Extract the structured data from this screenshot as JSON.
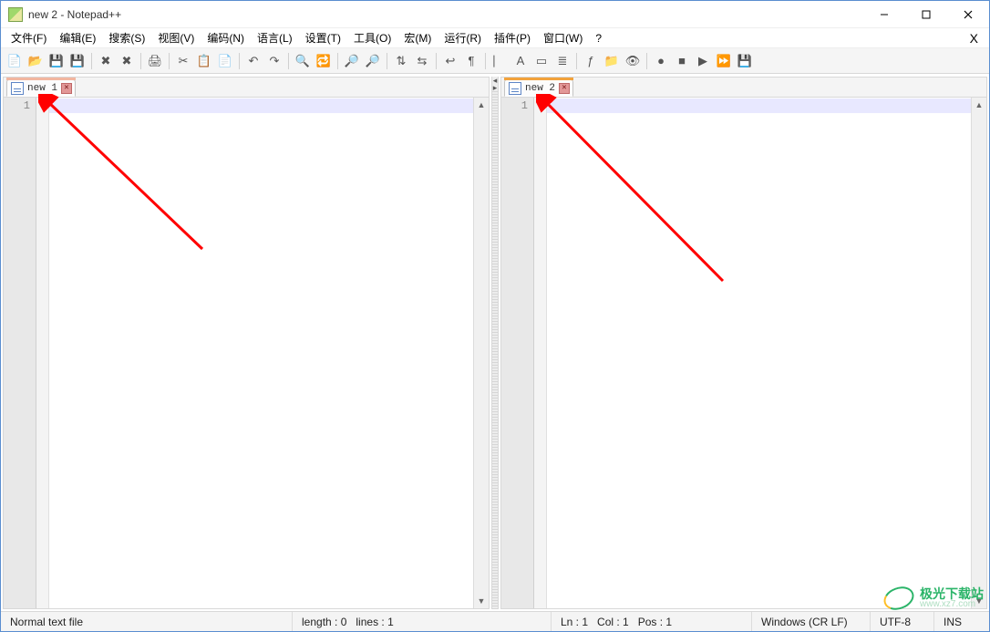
{
  "window": {
    "title": "new 2 - Notepad++"
  },
  "menu": {
    "items": [
      "文件(F)",
      "编辑(E)",
      "搜索(S)",
      "视图(V)",
      "编码(N)",
      "语言(L)",
      "设置(T)",
      "工具(O)",
      "宏(M)",
      "运行(R)",
      "插件(P)",
      "窗口(W)",
      "?"
    ],
    "right": "X"
  },
  "toolbar": {
    "icons": [
      "new-file",
      "open-file",
      "save",
      "save-all",
      "sep",
      "close",
      "close-all",
      "sep",
      "print",
      "sep",
      "cut",
      "copy",
      "paste",
      "sep",
      "undo",
      "redo",
      "sep",
      "find",
      "replace",
      "sep",
      "zoom-in",
      "zoom-out",
      "sep",
      "sync-v",
      "sync-h",
      "sep",
      "word-wrap",
      "show-all",
      "sep",
      "indent-guide",
      "lang",
      "doc-map",
      "doc-list",
      "sep",
      "function-list",
      "folder",
      "monitor",
      "sep",
      "record",
      "stop",
      "play",
      "play-multi",
      "save-macro"
    ]
  },
  "panes": {
    "left": {
      "tab_label": "new 1",
      "line_number": "1"
    },
    "right": {
      "tab_label": "new 2",
      "line_number": "1"
    }
  },
  "status": {
    "filetype": "Normal text file",
    "length_label": "length : 0",
    "lines_label": "lines : 1",
    "ln_label": "Ln : 1",
    "col_label": "Col : 1",
    "pos_label": "Pos : 1",
    "eol": "Windows (CR LF)",
    "encoding": "UTF-8",
    "mode": "INS"
  },
  "watermark": {
    "line1": "极光下载站",
    "line2": "www.xz7.com"
  }
}
